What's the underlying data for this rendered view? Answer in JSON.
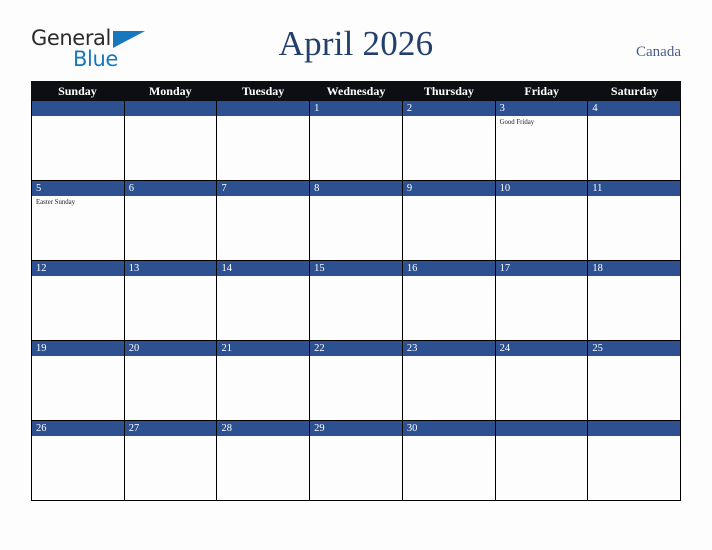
{
  "brand": {
    "name_part1": "General",
    "name_part2": "Blue",
    "triangle_icon": "triangle-icon",
    "color_dark": "#2b2b2b",
    "color_blue": "#1878be"
  },
  "header": {
    "title": "April 2026",
    "region": "Canada",
    "title_color": "#233f6b",
    "region_color": "#4a5e86"
  },
  "calendar": {
    "month": "April",
    "year": "2026",
    "band_color": "#2d5091",
    "header_bg": "#0d0d14",
    "border_color": "#000000",
    "day_names": [
      "Sunday",
      "Monday",
      "Tuesday",
      "Wednesday",
      "Thursday",
      "Friday",
      "Saturday"
    ],
    "weeks": [
      [
        {
          "date": "",
          "holiday": ""
        },
        {
          "date": "",
          "holiday": ""
        },
        {
          "date": "",
          "holiday": ""
        },
        {
          "date": "1",
          "holiday": ""
        },
        {
          "date": "2",
          "holiday": ""
        },
        {
          "date": "3",
          "holiday": "Good Friday"
        },
        {
          "date": "4",
          "holiday": ""
        }
      ],
      [
        {
          "date": "5",
          "holiday": "Easter Sunday"
        },
        {
          "date": "6",
          "holiday": ""
        },
        {
          "date": "7",
          "holiday": ""
        },
        {
          "date": "8",
          "holiday": ""
        },
        {
          "date": "9",
          "holiday": ""
        },
        {
          "date": "10",
          "holiday": ""
        },
        {
          "date": "11",
          "holiday": ""
        }
      ],
      [
        {
          "date": "12",
          "holiday": ""
        },
        {
          "date": "13",
          "holiday": ""
        },
        {
          "date": "14",
          "holiday": ""
        },
        {
          "date": "15",
          "holiday": ""
        },
        {
          "date": "16",
          "holiday": ""
        },
        {
          "date": "17",
          "holiday": ""
        },
        {
          "date": "18",
          "holiday": ""
        }
      ],
      [
        {
          "date": "19",
          "holiday": ""
        },
        {
          "date": "20",
          "holiday": ""
        },
        {
          "date": "21",
          "holiday": ""
        },
        {
          "date": "22",
          "holiday": ""
        },
        {
          "date": "23",
          "holiday": ""
        },
        {
          "date": "24",
          "holiday": ""
        },
        {
          "date": "25",
          "holiday": ""
        }
      ],
      [
        {
          "date": "26",
          "holiday": ""
        },
        {
          "date": "27",
          "holiday": ""
        },
        {
          "date": "28",
          "holiday": ""
        },
        {
          "date": "29",
          "holiday": ""
        },
        {
          "date": "30",
          "holiday": ""
        },
        {
          "date": "",
          "holiday": ""
        },
        {
          "date": "",
          "holiday": ""
        }
      ]
    ]
  }
}
